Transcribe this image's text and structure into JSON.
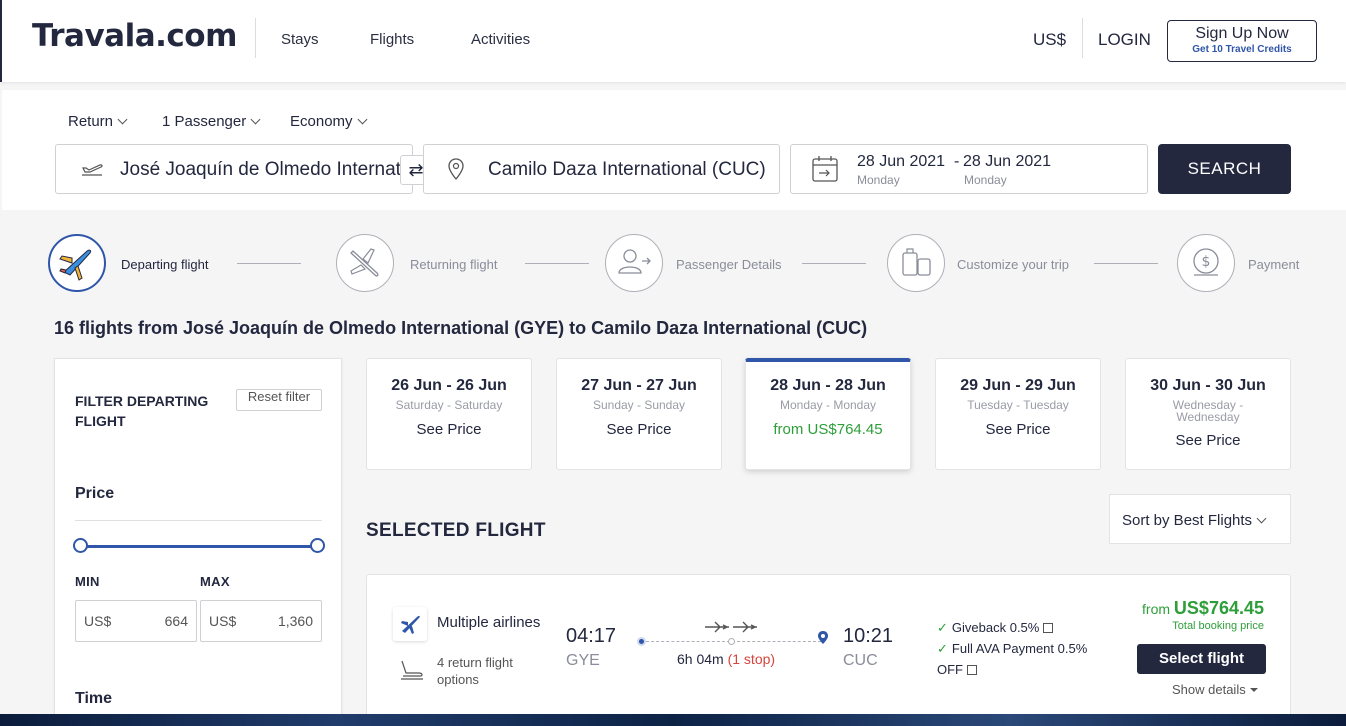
{
  "header": {
    "logo": "Travala.com",
    "nav": [
      "Stays",
      "Flights",
      "Activities"
    ],
    "currency": "US$",
    "login": "LOGIN",
    "signup_title": "Sign Up Now",
    "signup_sub": "Get 10 Travel Credits"
  },
  "search": {
    "trip_type": "Return",
    "passengers": "1 Passenger",
    "cabin": "Economy",
    "origin": "José Joaquín de Olmedo International (GYE)",
    "destination": "Camilo Daza International (CUC)",
    "depart_date": "28 Jun 2021",
    "depart_day": "Monday",
    "separator": "-",
    "return_date": "28 Jun 2021",
    "return_day": "Monday",
    "search_label": "SEARCH"
  },
  "steps": [
    {
      "label": "Departing flight",
      "icon": "plane-icon",
      "active": true
    },
    {
      "label": "Returning flight",
      "icon": "plane-icon",
      "active": false
    },
    {
      "label": "Passenger Details",
      "icon": "user-icon",
      "active": false
    },
    {
      "label": "Customize your trip",
      "icon": "luggage-icon",
      "active": false
    },
    {
      "label": "Payment",
      "icon": "money-icon",
      "active": false
    }
  ],
  "results_title": "16 flights from José Joaquín de Olmedo International (GYE) to Camilo Daza International (CUC)",
  "filter": {
    "title": "FILTER DEPARTING FLIGHT",
    "reset": "Reset filter",
    "price_label": "Price",
    "min_label": "MIN",
    "max_label": "MAX",
    "currency": "US$",
    "min_value": "664",
    "max_value": "1,360",
    "time_label": "Time"
  },
  "date_cards": [
    {
      "range": "26 Jun - 26 Jun",
      "days": "Saturday - Saturday",
      "price": "See Price"
    },
    {
      "range": "27 Jun - 27 Jun",
      "days": "Sunday - Sunday",
      "price": "See Price"
    },
    {
      "range": "28 Jun - 28 Jun",
      "days": "Monday - Monday",
      "price": "from US$764.45"
    },
    {
      "range": "29 Jun - 29 Jun",
      "days": "Tuesday - Tuesday",
      "price": "See Price"
    },
    {
      "range": "30 Jun - 30 Jun",
      "days": "Wednesday - Wednesday",
      "price": "See Price"
    }
  ],
  "sort_label": "Sort by Best Flights",
  "selected_flight_title": "SELECTED FLIGHT",
  "flight": {
    "airline": "Multiple airlines",
    "return_options": "4 return flight options",
    "depart_time": "04:17",
    "depart_code": "GYE",
    "duration": "6h 04m",
    "stops": "(1 stop)",
    "arrive_time": "10:21",
    "arrive_code": "CUC",
    "perk1": "Giveback 0.5%",
    "perk2": "Full AVA Payment 0.5% OFF",
    "from_label": "from",
    "price": "US$764.45",
    "total_label": "Total booking price",
    "select_label": "Select flight",
    "details_label": "Show details"
  },
  "colors": {
    "navy": "#23283f",
    "accent_blue": "#2f56a8",
    "green": "#2e9e3a",
    "stop_red": "#d6453d"
  }
}
